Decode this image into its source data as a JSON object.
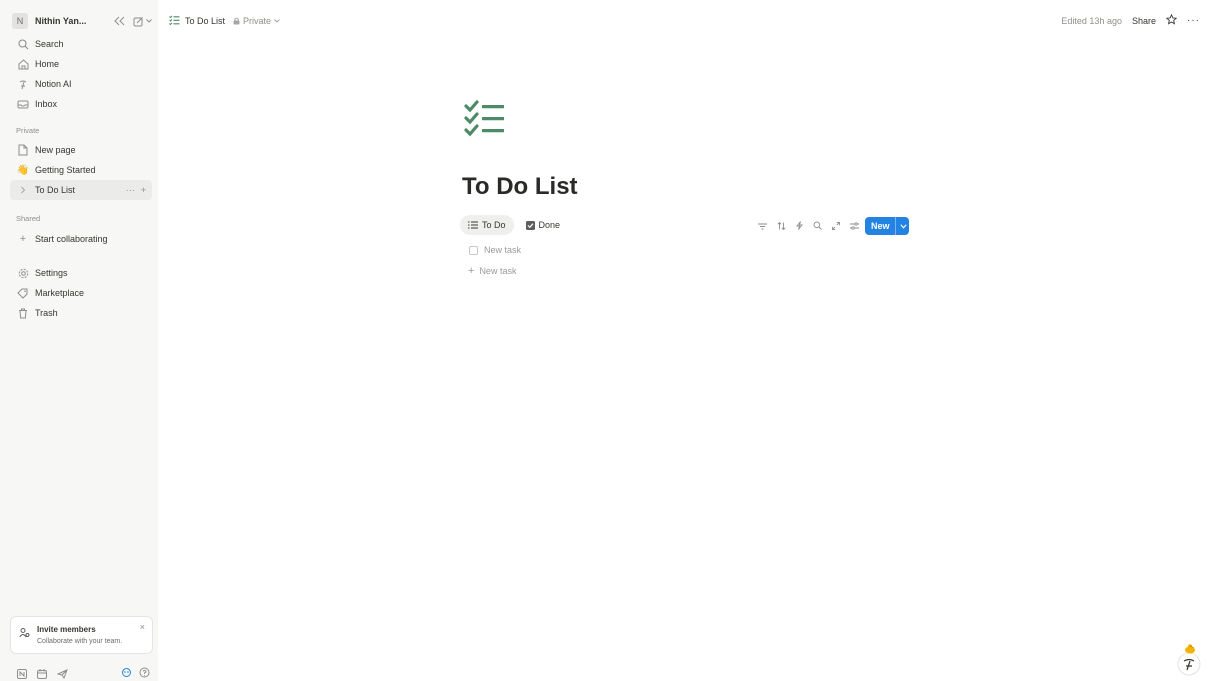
{
  "workspace": {
    "avatar": "N",
    "name": "Nithin Yan..."
  },
  "nav": {
    "search": "Search",
    "home": "Home",
    "notion_ai": "Notion AI",
    "inbox": "Inbox"
  },
  "private": {
    "label": "Private",
    "items": [
      "New page",
      "Getting Started",
      "To Do List"
    ]
  },
  "shared": {
    "label": "Shared",
    "start": "Start collaborating"
  },
  "tools": {
    "settings": "Settings",
    "marketplace": "Marketplace",
    "trash": "Trash"
  },
  "invite": {
    "title": "Invite members",
    "subtitle": "Collaborate with your team.",
    "close": "×"
  },
  "topbar": {
    "page": "To Do List",
    "privacy": "Private",
    "edited": "Edited 13h ago",
    "share": "Share"
  },
  "page": {
    "title": "To Do List",
    "views": [
      "To Do",
      "Done"
    ],
    "new_button": "New",
    "task_placeholder": "New task",
    "add_task": "New task"
  },
  "colors": {
    "accent": "#2383e2",
    "icon_green": "#4d8a66",
    "sidebar_bg": "#f7f7f5"
  }
}
